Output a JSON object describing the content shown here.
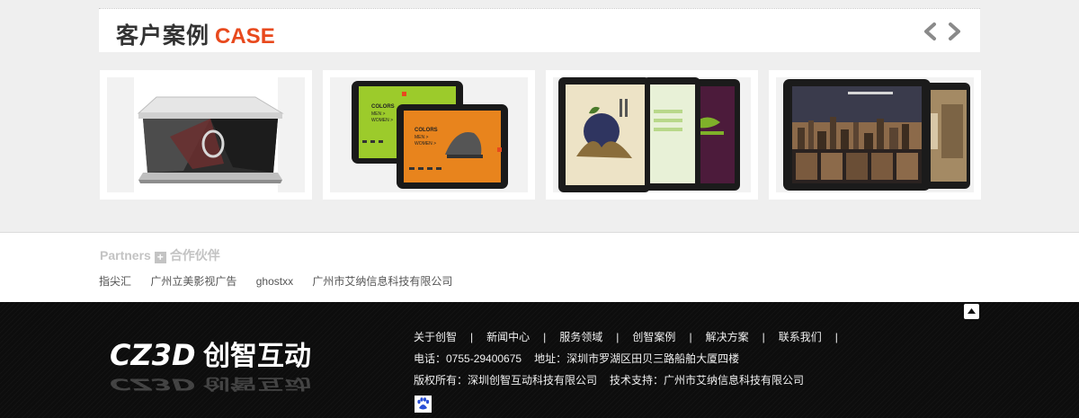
{
  "case": {
    "title_cn": "客户案例",
    "title_en": "CASE",
    "prev_icon": "chevron-left-icon",
    "next_icon": "chevron-right-icon",
    "accent": "#e8491d",
    "items": [
      {
        "image": "holographic-pyramid-display"
      },
      {
        "image": "tablet-shoe-ads",
        "text_a": "COLORS",
        "text_b": "MEN >",
        "text_c": "WOMEN >"
      },
      {
        "image": "tablet-chinese-brochure"
      },
      {
        "image": "tablet-city-website"
      }
    ]
  },
  "partners": {
    "title_en": "Partners",
    "title_cn": "合作伙伴",
    "links": [
      "指尖汇",
      "广州立美影视广告",
      "ghostxx",
      "广州市艾纳信息科技有限公司"
    ]
  },
  "footer": {
    "logo_text": "CZ3D",
    "logo_cn": "创智互动",
    "nav": [
      "关于创智",
      "新闻中心",
      "服务领域",
      "创智案例",
      "解决方案",
      "联系我们"
    ],
    "nav_separator": "|",
    "phone": "电话：0755-29400675",
    "address": "地址：深圳市罗湖区田贝三路船舶大厦四楼",
    "copyright": "版权所有：深圳创智互动科技有限公司",
    "support": "技术支持：广州市艾纳信息科技有限公司",
    "back_top_icon": "back-to-top-icon",
    "stat_icon": "baidu-paw-icon"
  }
}
